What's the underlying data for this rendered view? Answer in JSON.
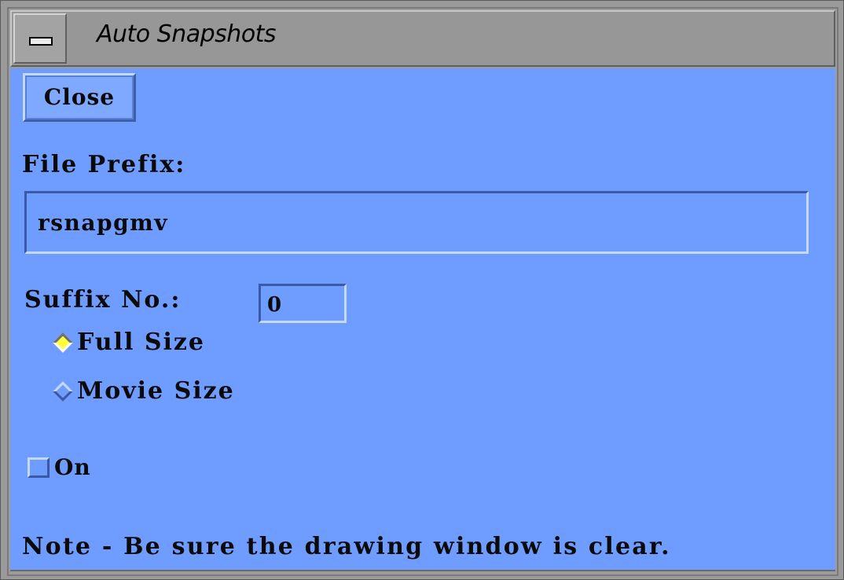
{
  "window": {
    "title": "Auto Snapshots"
  },
  "buttons": {
    "close_label": "Close"
  },
  "file_prefix": {
    "label": "File Prefix:",
    "value": "rsnapgmv"
  },
  "suffix": {
    "label": "Suffix No.:",
    "value": "0"
  },
  "size_options": [
    {
      "label": "Full Size",
      "selected": true
    },
    {
      "label": "Movie Size",
      "selected": false
    }
  ],
  "toggle": {
    "label": "On",
    "checked": false
  },
  "note": "Note - Be sure the drawing window is clear.",
  "colors": {
    "panel_bg": "#6f9cff",
    "radio_selected": "#ffff3a",
    "titlebar_bg": "#979797"
  },
  "icons": {
    "window_menu": "window-menu-icon"
  }
}
